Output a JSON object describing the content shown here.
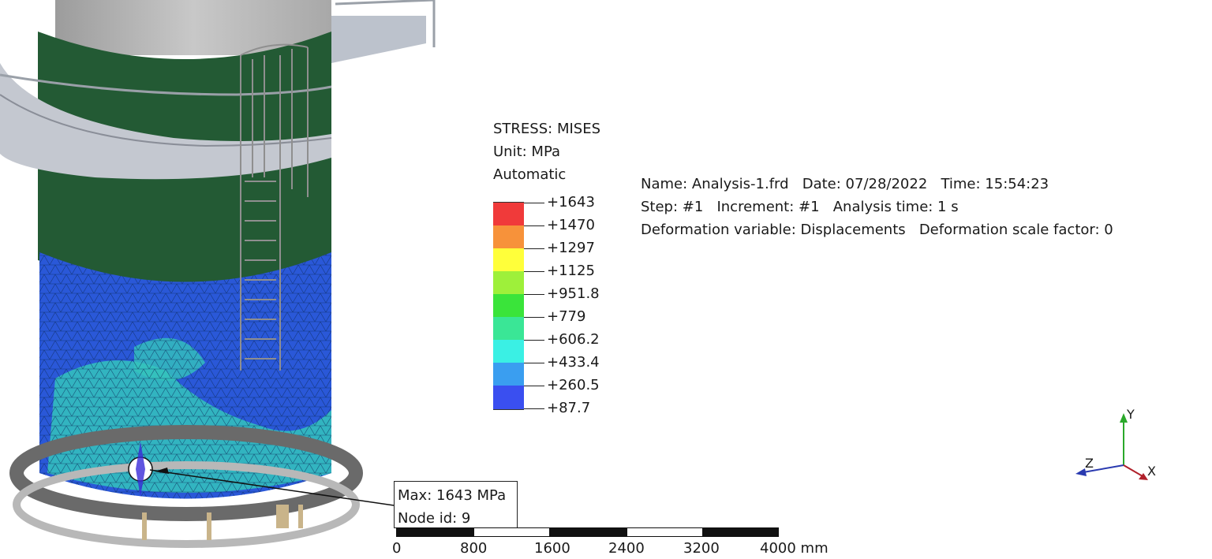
{
  "legend": {
    "title": "STRESS: MISES",
    "unit": "Unit: MPa",
    "mode": "Automatic",
    "entries": [
      {
        "label": "+1643",
        "color": "#f03a3a"
      },
      {
        "label": "+1470",
        "color": "#f7923a"
      },
      {
        "label": "+1297",
        "color": "#ffff3a"
      },
      {
        "label": "+1125",
        "color": "#9ef03a"
      },
      {
        "label": "+951.8",
        "color": "#3ae43a"
      },
      {
        "label": "+779",
        "color": "#3ae696"
      },
      {
        "label": "+606.2",
        "color": "#3af0e4"
      },
      {
        "label": "+433.4",
        "color": "#3a9ef0"
      },
      {
        "label": "+260.5",
        "color": "#3a4ff0"
      },
      {
        "label": "+87.7",
        "color": null
      }
    ]
  },
  "info": {
    "line1": "Name: Analysis-1.frd   Date: 07/28/2022   Time: 15:54:23",
    "line2": "Step: #1   Increment: #1   Analysis time: 1 s",
    "line3": "Deformation variable: Displacements   Deformation scale factor: 0"
  },
  "probe": {
    "max": "Max: 1643 MPa",
    "node": "Node id: 9"
  },
  "scale_bar": {
    "labels": [
      "0",
      "800",
      "1600",
      "2400",
      "3200",
      "4000 mm"
    ]
  },
  "axes": {
    "x": "X",
    "y": "Y",
    "z": "Z",
    "colors": {
      "x": "#b0202a",
      "y": "#2aa82a",
      "z": "#2a3ab0"
    }
  }
}
